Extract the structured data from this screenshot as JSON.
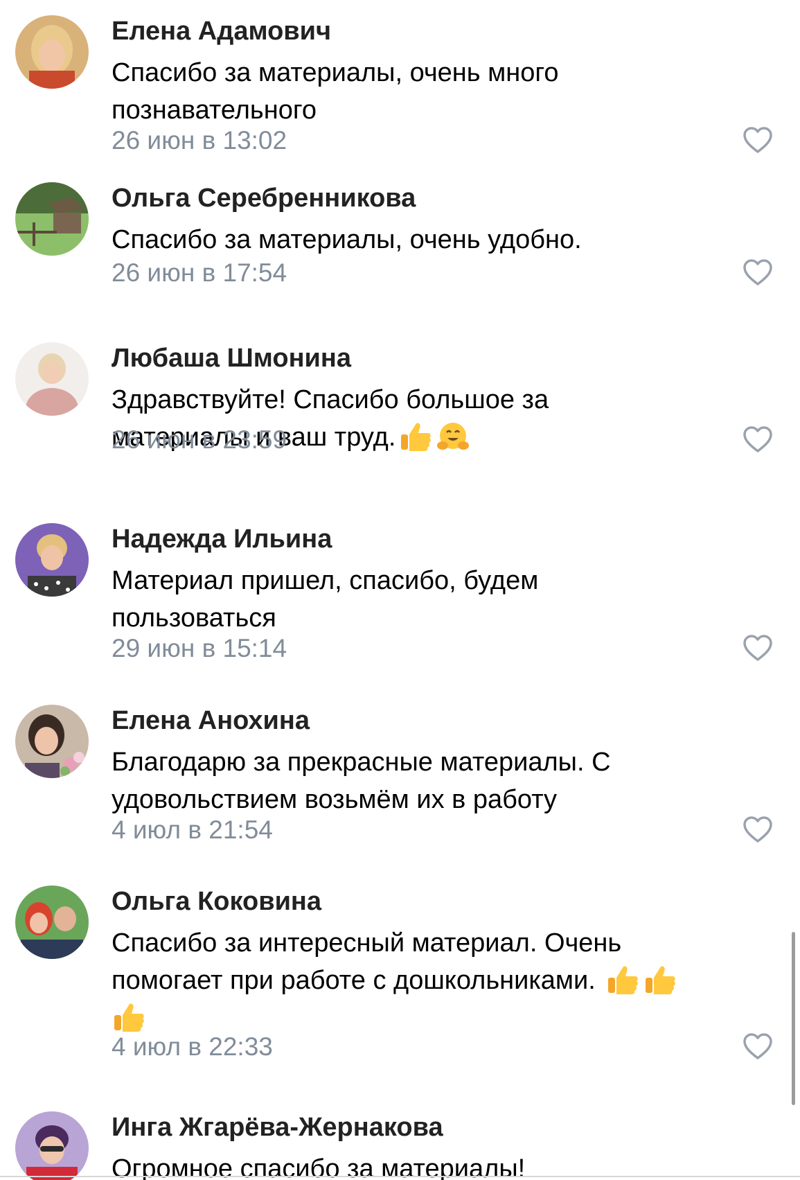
{
  "comments": [
    {
      "author": "Елена Адамович",
      "lines": [
        "Спасибо за материалы, очень много",
        "познавательного"
      ],
      "time": "26 июн в 13:02",
      "avatar_icon": "avatar-photo-blonde-woman"
    },
    {
      "author": "Ольга Серебренникова",
      "lines": [
        "Спасибо за материалы, очень удобно."
      ],
      "time": "26 июн в 17:54",
      "avatar_icon": "avatar-photo-landscape-hut"
    },
    {
      "author": "Любаша Шмонина",
      "lines": [
        "Здравствуйте! Спасибо большое за",
        "материалы и ваш труд."
      ],
      "emoji": [
        "thumbs-up-icon",
        "hugging-face-icon"
      ],
      "time": "26 июн в 23:59",
      "avatar_icon": "avatar-photo-woman-pink"
    },
    {
      "author": "Надежда Ильина",
      "lines": [
        "Материал пришел, спасибо, будем",
        "пользоваться"
      ],
      "time": "29 июн в 15:14",
      "avatar_icon": "avatar-photo-woman-purple-bg"
    },
    {
      "author": "Елена Анохина",
      "lines": [
        "Благодарю за прекрасные материалы. С",
        "удовольствием возьмём их в работу"
      ],
      "time": "4 июл в 21:54",
      "avatar_icon": "avatar-photo-woman-flowers"
    },
    {
      "author": "Ольга Коковина",
      "lines": [
        "Спасибо за интересный материал. Очень",
        "помогает при работе с дошкольниками."
      ],
      "emoji": [
        "thumbs-up-icon",
        "thumbs-up-icon",
        "thumbs-up-icon"
      ],
      "time": "4 июл в 22:33",
      "avatar_icon": "avatar-photo-couple"
    },
    {
      "author": "Инга Жгарёва-Жернакова",
      "lines": [
        "Огромное спасибо за материалы!"
      ],
      "avatar_icon": "avatar-photo-woman-glasses"
    }
  ],
  "colors": {
    "author": "#222222",
    "text": "#000000",
    "timestamp": "#818c99",
    "like_icon": "#99a2ad"
  },
  "icons": {
    "like": "heart-outline-icon"
  }
}
